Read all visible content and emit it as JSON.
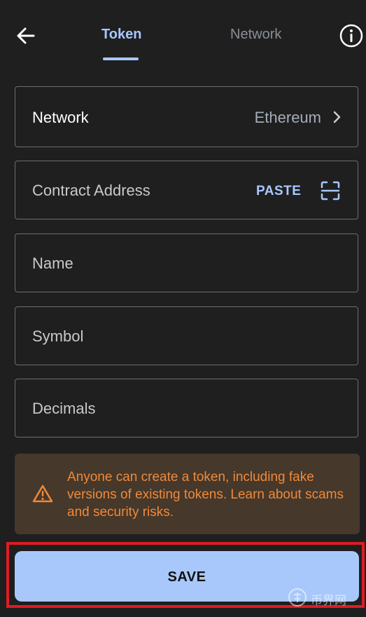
{
  "header": {
    "back_icon": "arrow-left-icon",
    "tabs": [
      {
        "label": "Token",
        "active": true
      },
      {
        "label": "Network",
        "active": false
      }
    ],
    "info_icon": "info-circle-icon"
  },
  "form": {
    "network": {
      "label": "Network",
      "value": "Ethereum",
      "icon": "chevron-right-icon"
    },
    "contract_address": {
      "label": "Contract Address",
      "paste_label": "PASTE",
      "scan_icon": "scan-qr-icon"
    },
    "name": {
      "label": "Name"
    },
    "symbol": {
      "label": "Symbol"
    },
    "decimals": {
      "label": "Decimals"
    }
  },
  "warning": {
    "icon": "warning-triangle-icon",
    "text_before": "Anyone can create a token, including fake versions of existing tokens. ",
    "link_text": "Learn about scams and security risks."
  },
  "save_button": {
    "label": "SAVE"
  },
  "watermark": {
    "text": "币界网",
    "icon": "watermark-logo"
  },
  "colors": {
    "accent": "#a8c8ff",
    "background": "#1f1f1f",
    "warning_bg": "#46382a",
    "warning_text": "#f0893a",
    "highlight": "#e01b24"
  }
}
